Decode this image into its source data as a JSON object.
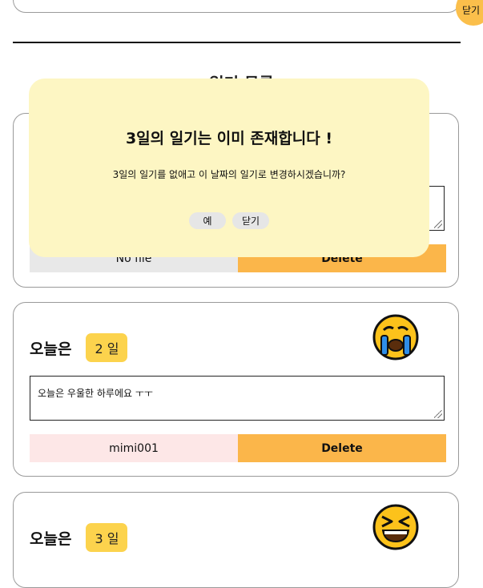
{
  "top_close_label": "닫기",
  "section_title": "일기 목록",
  "cards": [
    {
      "file_label": "No file",
      "delete_label": "Delete",
      "file_bg": "#e8e8e8"
    },
    {
      "today_label": "오늘은",
      "day": "2 일",
      "memo": "오늘은 우울한 하루에요 ㅜㅜ",
      "file_label": "mimi001",
      "delete_label": "Delete",
      "mood_icon": "crying-face",
      "file_bg": "#fde7e7"
    },
    {
      "today_label": "오늘은",
      "day": "3 일",
      "mood_icon": "laughing-face"
    }
  ],
  "modal": {
    "title": "3일의 일기는 이미 존재합니다 !",
    "message": "3일의 일기를 없애고 이 날짜의 일기로 변경하시겠습니까?",
    "confirm_label": "예",
    "close_label": "닫기"
  },
  "colors": {
    "accent": "#fbb64a",
    "badge": "#fcd34d",
    "modal_bg": "#fdf6c3"
  }
}
